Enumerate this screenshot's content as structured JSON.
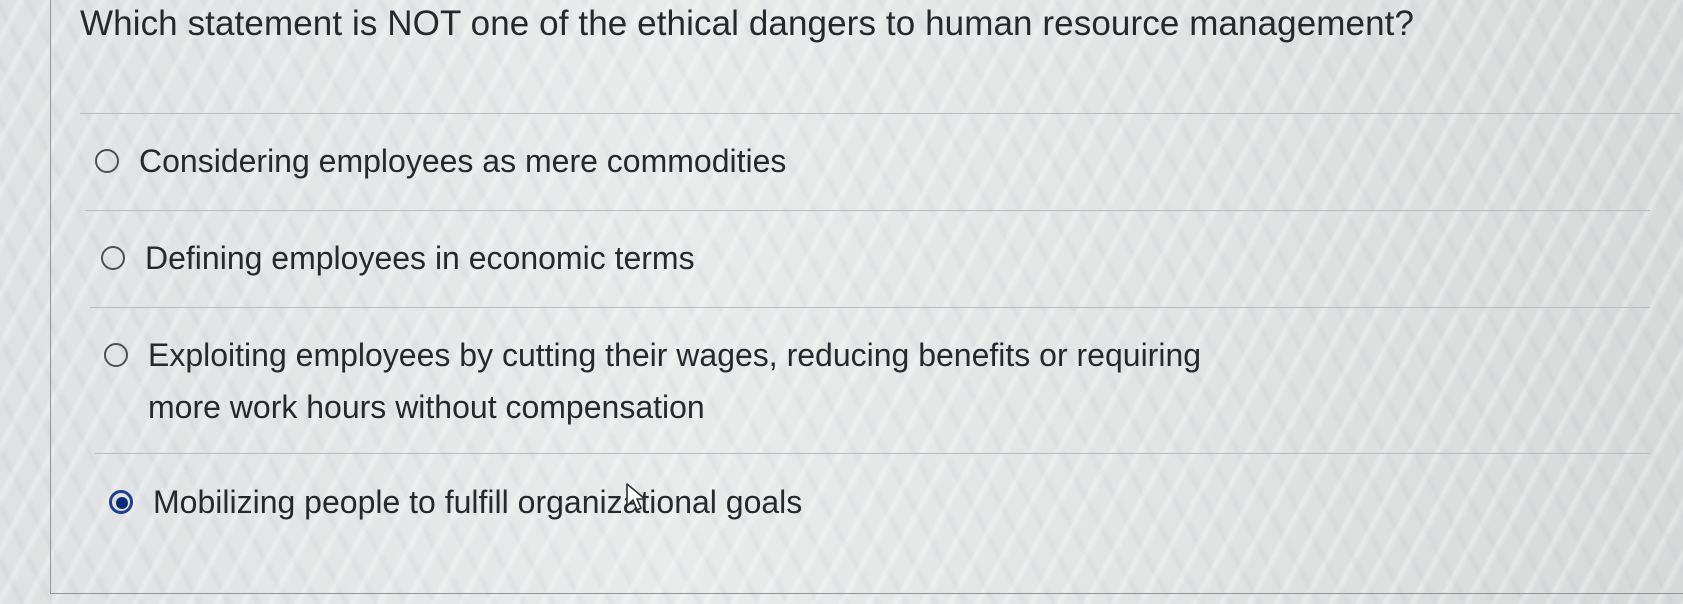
{
  "question": {
    "text": "Which statement is NOT one of the ethical dangers to human resource management?"
  },
  "options": [
    {
      "label": "Considering employees as mere commodities",
      "selected": false
    },
    {
      "label": "Defining employees in economic terms",
      "selected": false
    },
    {
      "label": "Exploiting employees by cutting their wages, reducing benefits or requiring",
      "label_line2": "more work hours without compensation",
      "selected": false
    },
    {
      "label": "Mobilizing people to fulfill organizational goals",
      "selected": true
    }
  ],
  "colors": {
    "selected_radio": "#0d2a78",
    "text": "#25282d",
    "divider": "#b7bcc0"
  },
  "icons": {
    "cursor": "mouse-pointer-icon"
  }
}
